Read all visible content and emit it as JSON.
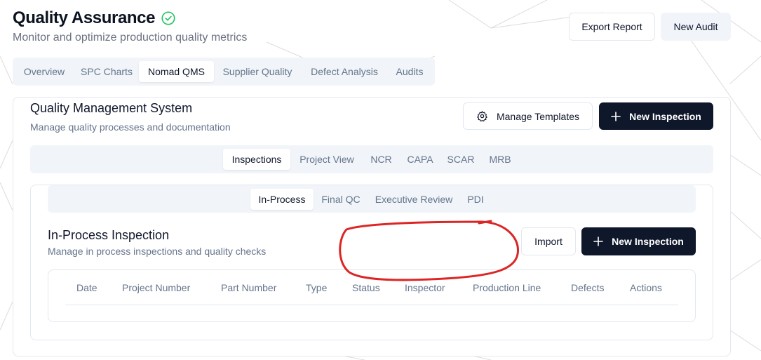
{
  "header": {
    "title": "Quality Assurance",
    "subtitle": "Monitor and optimize production quality metrics",
    "export_label": "Export Report",
    "new_audit_label": "New Audit"
  },
  "main_tabs": [
    {
      "label": "Overview",
      "active": false
    },
    {
      "label": "SPC Charts",
      "active": false
    },
    {
      "label": "Nomad QMS",
      "active": true
    },
    {
      "label": "Supplier Quality",
      "active": false
    },
    {
      "label": "Defect Analysis",
      "active": false
    },
    {
      "label": "Audits",
      "active": false
    }
  ],
  "qms": {
    "title": "Quality Management System",
    "description": "Manage quality processes and documentation",
    "manage_templates_label": "Manage Templates",
    "new_inspection_label": "New Inspection",
    "tabs": [
      {
        "label": "Inspections",
        "active": true
      },
      {
        "label": "Project View",
        "active": false
      },
      {
        "label": "NCR",
        "active": false
      },
      {
        "label": "CAPA",
        "active": false
      },
      {
        "label": "SCAR",
        "active": false
      },
      {
        "label": "MRB",
        "active": false
      }
    ]
  },
  "inspection": {
    "tabs": [
      {
        "label": "In-Process",
        "active": true
      },
      {
        "label": "Final QC",
        "active": false
      },
      {
        "label": "Executive Review",
        "active": false
      },
      {
        "label": "PDI",
        "active": false
      }
    ],
    "title": "In-Process Inspection",
    "description": "Manage in process inspections and quality checks",
    "import_label": "Import",
    "new_inspection_label": "New Inspection",
    "table_headers": [
      "Date",
      "Project Number",
      "Part Number",
      "Type",
      "Status",
      "Inspector",
      "Production Line",
      "Defects",
      "Actions"
    ]
  },
  "colors": {
    "accent_dark": "#0f172a",
    "success": "#22c55e",
    "annotation": "#dc2626"
  }
}
